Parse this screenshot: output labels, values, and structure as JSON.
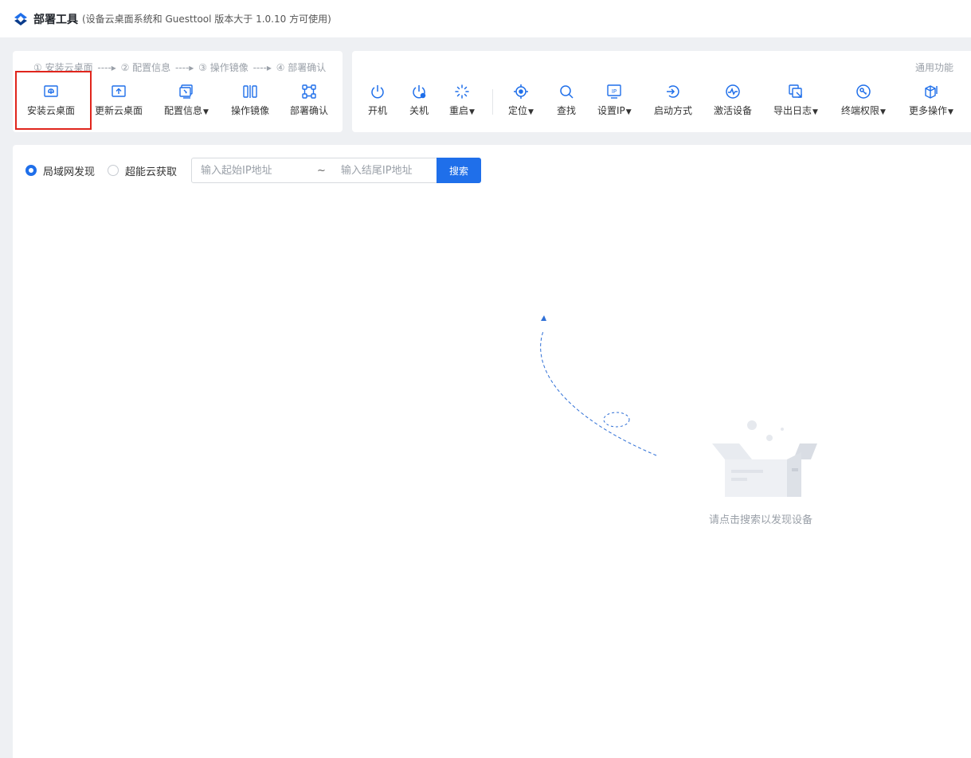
{
  "app": {
    "title": "部署工具",
    "note": "(设备云桌面系统和 Guesttool 版本大于 1.0.10 方可使用)",
    "logo_icon": "app-logo-icon"
  },
  "steps": {
    "s1": "① 安装云桌面",
    "s2": "② 配置信息",
    "s3": "③ 操作镜像",
    "s4": "④ 部署确认",
    "arrow": "----▸"
  },
  "deploy_tools": [
    {
      "label": "安装云桌面",
      "icon": "install-cloud-desktop-icon"
    },
    {
      "label": "更新云桌面",
      "icon": "update-cloud-desktop-icon"
    },
    {
      "label": "配置信息",
      "icon": "config-info-icon",
      "caret": "▼"
    },
    {
      "label": "操作镜像",
      "icon": "operate-image-icon"
    },
    {
      "label": "部署确认",
      "icon": "deploy-confirm-icon"
    }
  ],
  "common": {
    "label": "通用功能",
    "tools": [
      {
        "label": "开机",
        "icon": "power-on-icon"
      },
      {
        "label": "关机",
        "icon": "power-off-icon"
      },
      {
        "label": "重启",
        "icon": "restart-icon",
        "caret": "▼"
      },
      {
        "label": "定位",
        "icon": "locate-icon",
        "caret": "▼"
      },
      {
        "label": "查找",
        "icon": "search-icon"
      },
      {
        "label": "设置IP",
        "icon": "set-ip-icon",
        "caret": "▼"
      },
      {
        "label": "启动方式",
        "icon": "boot-mode-icon"
      },
      {
        "label": "激活设备",
        "icon": "activate-device-icon"
      },
      {
        "label": "导出日志",
        "icon": "export-log-icon",
        "caret": "▼"
      },
      {
        "label": "终端权限",
        "icon": "terminal-permission-icon",
        "caret": "▼"
      },
      {
        "label": "更多操作",
        "icon": "more-actions-icon",
        "caret": "▼"
      }
    ]
  },
  "discovery": {
    "lan": "局域网发现",
    "cloud": "超能云获取",
    "selected": "局域网发现"
  },
  "ip_range": {
    "start_placeholder": "输入起始IP地址",
    "separator": "~",
    "end_placeholder": "输入结尾IP地址",
    "start_value": "",
    "end_value": ""
  },
  "search_button": "搜索",
  "empty_state": {
    "text": "请点击搜索以发现设备",
    "illustration": "empty-box-illustration"
  },
  "colors": {
    "accent": "#1f6fea",
    "highlight": "#e0251c",
    "muted": "#9aa0a8"
  }
}
